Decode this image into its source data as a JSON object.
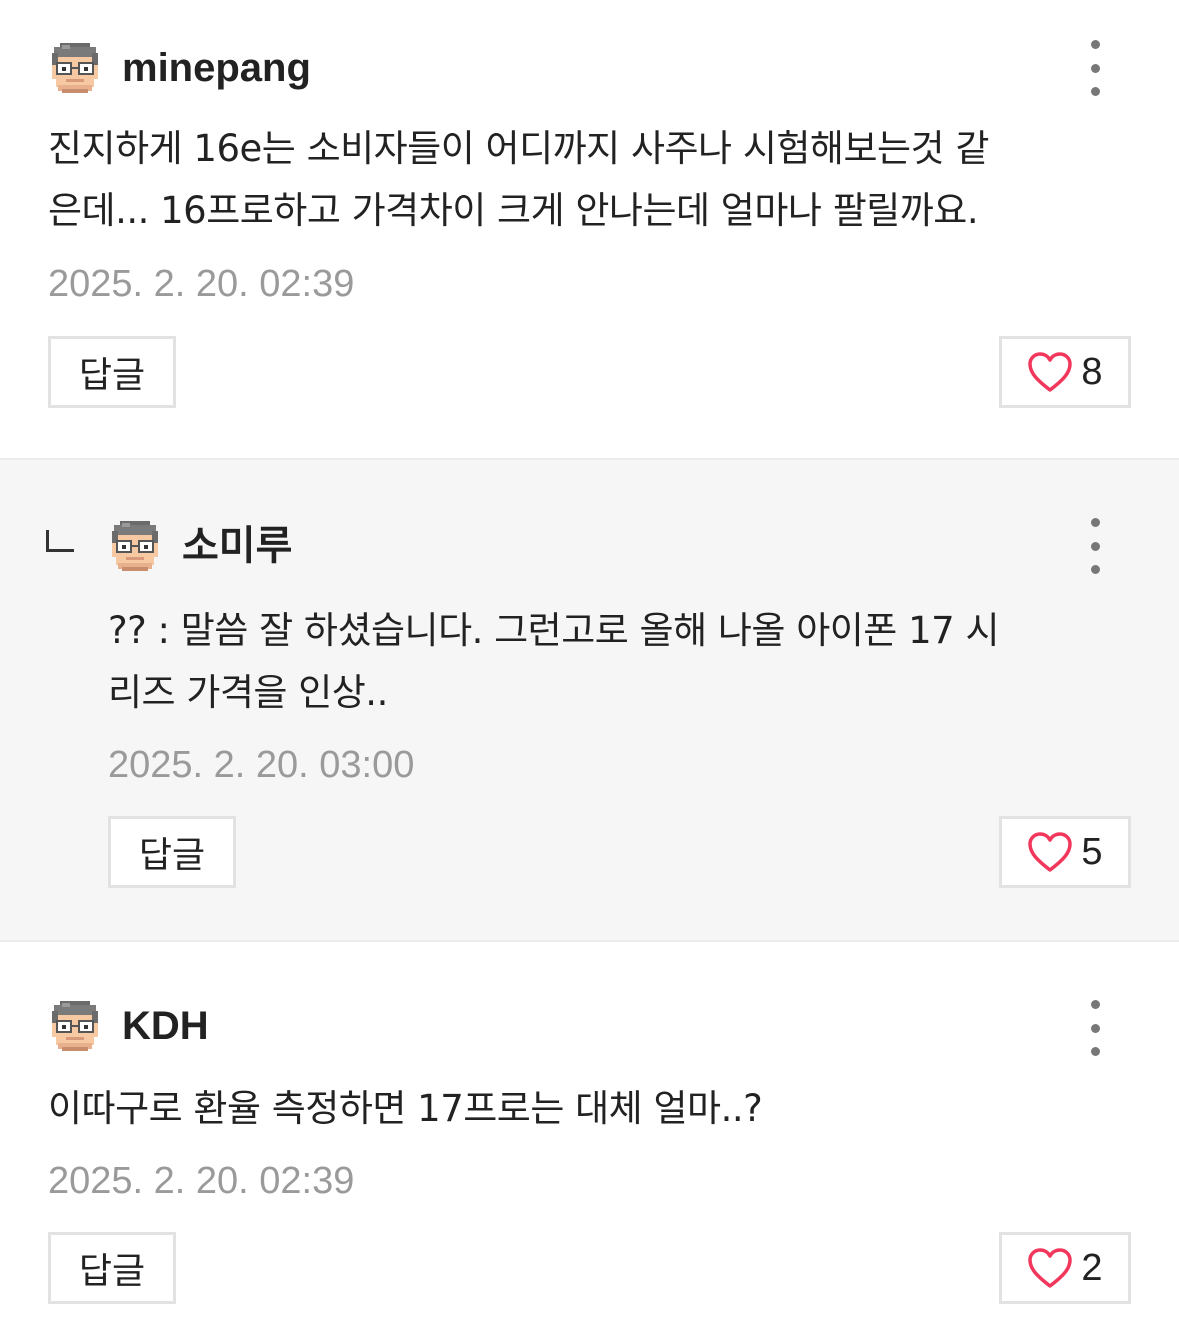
{
  "colors": {
    "heart": "#f2365c",
    "reply_background": "#f6f6f6",
    "timestamp": "#9a9a9a"
  },
  "comments": [
    {
      "author": "minepang",
      "body_line1": "진지하게 16e는 소비자들이 어디까지 사주나 시험해보는것 같",
      "body_line2": "은데... 16프로하고 가격차이 크게  안나는데 얼마나 팔릴까요.",
      "timestamp": "2025. 2. 20. 02:39",
      "reply_label": "답글",
      "likes": "8",
      "avatar_icon": "pixel-avatar-icon",
      "more_icon": "more-vertical-icon"
    },
    {
      "author": "소미루",
      "body_line1": "?? : 말씀 잘 하셨습니다.  그런고로 올해 나올 아이폰 17 시",
      "body_line2": "리즈 가격을 인상..",
      "timestamp": "2025. 2. 20. 03:00",
      "reply_label": "답글",
      "likes": "5",
      "avatar_icon": "pixel-avatar-icon",
      "more_icon": "more-vertical-icon",
      "is_reply": true
    },
    {
      "author": "KDH",
      "body_line1": "이따구로 환율 측정하면 17프로는 대체 얼마..?",
      "timestamp": "2025. 2. 20. 02:39",
      "reply_label": "답글",
      "likes": "2",
      "avatar_icon": "pixel-avatar-icon",
      "more_icon": "more-vertical-icon"
    }
  ]
}
